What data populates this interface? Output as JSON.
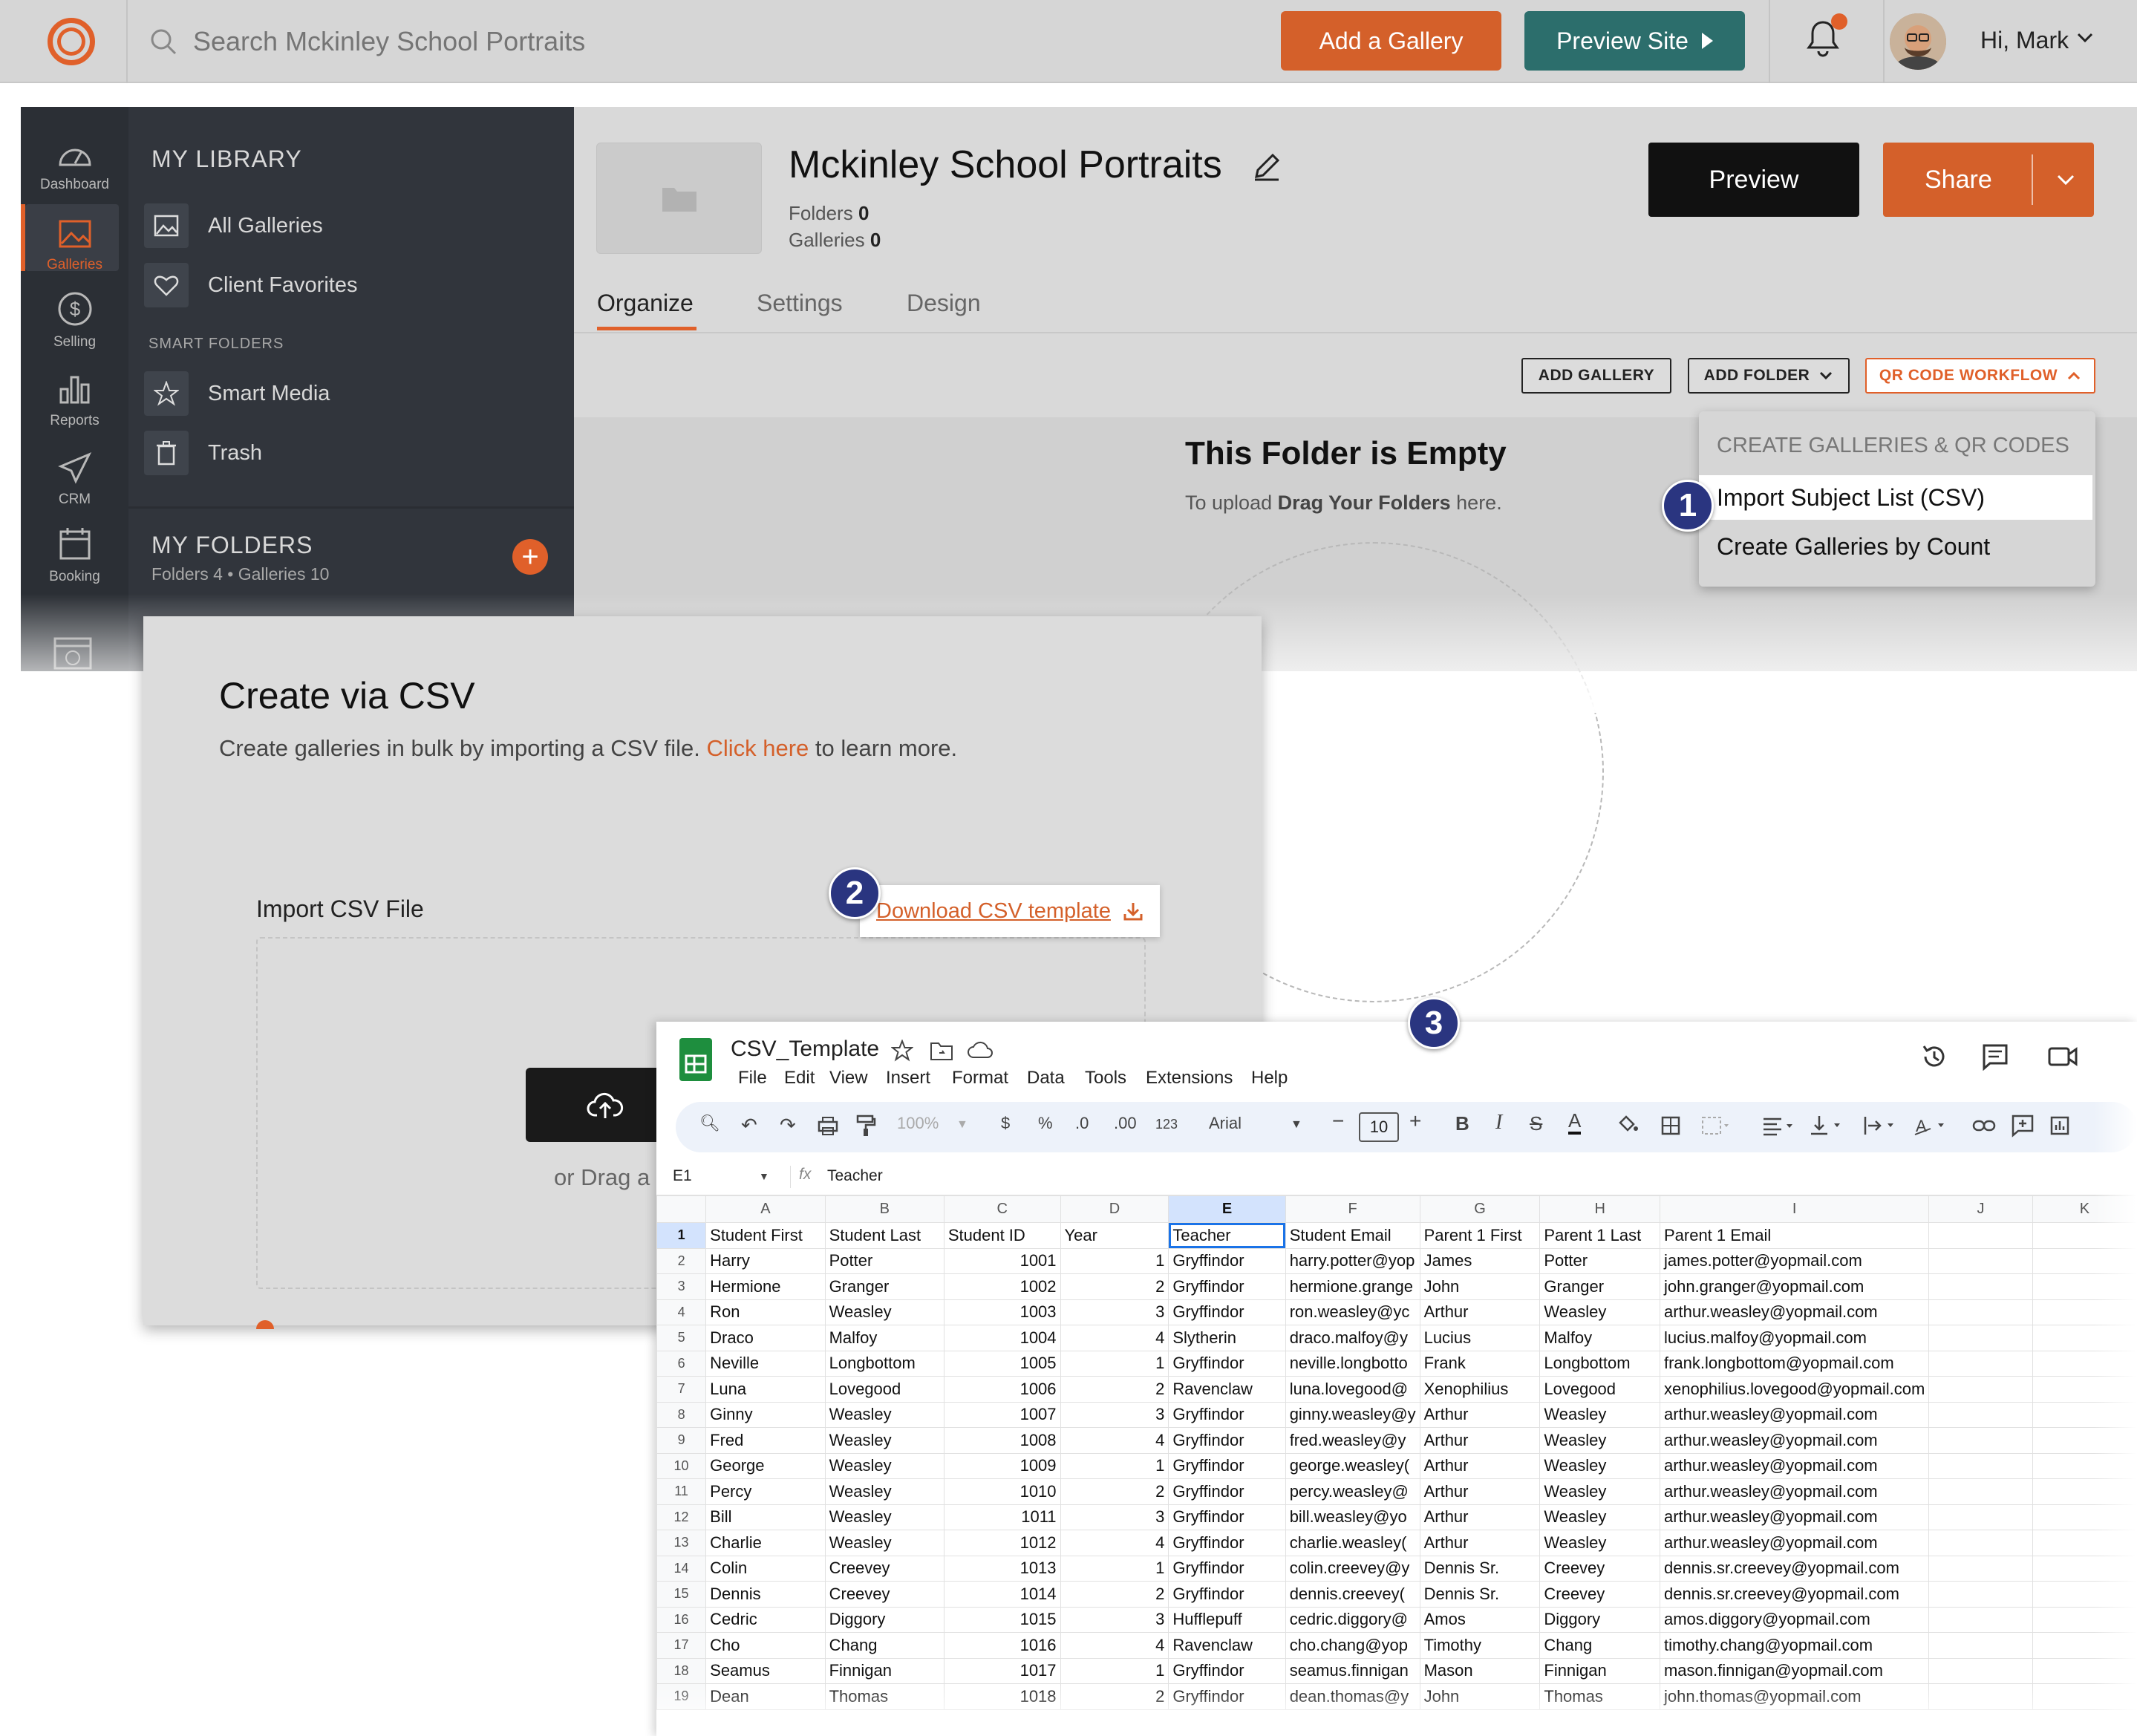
{
  "topbar": {
    "search_placeholder": "Search Mckinley School Portraits",
    "add_gallery": "Add a Gallery",
    "preview_site": "Preview Site",
    "greeting": "Hi, Mark"
  },
  "rail": {
    "items": [
      "Dashboard",
      "Galleries",
      "Selling",
      "Reports",
      "CRM",
      "Booking"
    ],
    "active": "Galleries"
  },
  "library": {
    "heading": "MY LIBRARY",
    "all_galleries": "All Galleries",
    "client_favorites": "Client Favorites",
    "smart_folders_heading": "SMART FOLDERS",
    "smart_media": "Smart Media",
    "trash": "Trash",
    "my_folders_heading": "MY FOLDERS",
    "my_folders_sub": "Folders 4 • Galleries 10"
  },
  "main": {
    "title": "Mckinley School Portraits",
    "folders_label": "Folders",
    "folders_count": "0",
    "galleries_label": "Galleries",
    "galleries_count": "0",
    "preview": "Preview",
    "share": "Share",
    "tabs": [
      "Organize",
      "Settings",
      "Design"
    ],
    "add_gallery_small": "ADD GALLERY",
    "add_folder_small": "ADD FOLDER",
    "qr_workflow": "QR CODE WORKFLOW",
    "empty_title": "This Folder is Empty",
    "empty_sub_prefix": "To upload ",
    "empty_sub_bold": "Drag Your Folders",
    "empty_sub_suffix": " here."
  },
  "dropdown": {
    "heading": "CREATE GALLERIES & QR CODES",
    "import": "Import Subject List (CSV)",
    "by_count": "Create Galleries by Count"
  },
  "badges": [
    "1",
    "2",
    "3"
  ],
  "modal": {
    "title": "Create via CSV",
    "desc_prefix": "Create galleries in bulk by importing a CSV file. ",
    "desc_link": "Click here",
    "desc_suffix": " to learn more.",
    "import_label": "Import CSV File",
    "download_template": "Download CSV template",
    "or_drag": "or Drag a"
  },
  "sheet": {
    "doc_title": "CSV_Template",
    "menu": [
      "File",
      "Edit",
      "View",
      "Insert",
      "Format",
      "Data",
      "Tools",
      "Extensions",
      "Help"
    ],
    "zoom": "100%",
    "currency": "$",
    "percent": "%",
    "dec_less": ".0",
    "dec_more": ".00",
    "number_format": "123",
    "font": "Arial",
    "font_size": "10",
    "cell_ref": "E1",
    "formula": "Teacher",
    "columns": [
      "A",
      "B",
      "C",
      "D",
      "E",
      "F",
      "G",
      "H",
      "I",
      "J",
      "K"
    ],
    "selected_column": "E",
    "rows": [
      [
        "1",
        "Student First",
        "Student Last",
        "Student ID",
        "Year",
        "Teacher",
        "Student Email",
        "Parent 1 First",
        "Parent 1 Last",
        "Parent 1 Email",
        "",
        ""
      ],
      [
        "2",
        "Harry",
        "Potter",
        "1001",
        "1",
        "Gryffindor",
        "harry.potter@yop",
        "James",
        "Potter",
        "james.potter@yopmail.com",
        "",
        ""
      ],
      [
        "3",
        "Hermione",
        "Granger",
        "1002",
        "2",
        "Gryffindor",
        "hermione.grange",
        "John",
        "Granger",
        "john.granger@yopmail.com",
        "",
        ""
      ],
      [
        "4",
        "Ron",
        "Weasley",
        "1003",
        "3",
        "Gryffindor",
        "ron.weasley@yc",
        "Arthur",
        "Weasley",
        "arthur.weasley@yopmail.com",
        "",
        ""
      ],
      [
        "5",
        "Draco",
        "Malfoy",
        "1004",
        "4",
        "Slytherin",
        "draco.malfoy@y",
        "Lucius",
        "Malfoy",
        "lucius.malfoy@yopmail.com",
        "",
        ""
      ],
      [
        "6",
        "Neville",
        "Longbottom",
        "1005",
        "1",
        "Gryffindor",
        "neville.longbotto",
        "Frank",
        "Longbottom",
        "frank.longbottom@yopmail.com",
        "",
        ""
      ],
      [
        "7",
        "Luna",
        "Lovegood",
        "1006",
        "2",
        "Ravenclaw",
        "luna.lovegood@",
        "Xenophilius",
        "Lovegood",
        "xenophilius.lovegood@yopmail.com",
        "",
        ""
      ],
      [
        "8",
        "Ginny",
        "Weasley",
        "1007",
        "3",
        "Gryffindor",
        "ginny.weasley@y",
        "Arthur",
        "Weasley",
        "arthur.weasley@yopmail.com",
        "",
        ""
      ],
      [
        "9",
        "Fred",
        "Weasley",
        "1008",
        "4",
        "Gryffindor",
        "fred.weasley@y",
        "Arthur",
        "Weasley",
        "arthur.weasley@yopmail.com",
        "",
        ""
      ],
      [
        "10",
        "George",
        "Weasley",
        "1009",
        "1",
        "Gryffindor",
        "george.weasley(",
        "Arthur",
        "Weasley",
        "arthur.weasley@yopmail.com",
        "",
        ""
      ],
      [
        "11",
        "Percy",
        "Weasley",
        "1010",
        "2",
        "Gryffindor",
        "percy.weasley@",
        "Arthur",
        "Weasley",
        "arthur.weasley@yopmail.com",
        "",
        ""
      ],
      [
        "12",
        "Bill",
        "Weasley",
        "1011",
        "3",
        "Gryffindor",
        "bill.weasley@yo",
        "Arthur",
        "Weasley",
        "arthur.weasley@yopmail.com",
        "",
        ""
      ],
      [
        "13",
        "Charlie",
        "Weasley",
        "1012",
        "4",
        "Gryffindor",
        "charlie.weasley(",
        "Arthur",
        "Weasley",
        "arthur.weasley@yopmail.com",
        "",
        ""
      ],
      [
        "14",
        "Colin",
        "Creevey",
        "1013",
        "1",
        "Gryffindor",
        "colin.creevey@y",
        "Dennis Sr.",
        "Creevey",
        "dennis.sr.creevey@yopmail.com",
        "",
        ""
      ],
      [
        "15",
        "Dennis",
        "Creevey",
        "1014",
        "2",
        "Gryffindor",
        "dennis.creevey(",
        "Dennis Sr.",
        "Creevey",
        "dennis.sr.creevey@yopmail.com",
        "",
        ""
      ],
      [
        "16",
        "Cedric",
        "Diggory",
        "1015",
        "3",
        "Hufflepuff",
        "cedric.diggory@",
        "Amos",
        "Diggory",
        "amos.diggory@yopmail.com",
        "",
        ""
      ],
      [
        "17",
        "Cho",
        "Chang",
        "1016",
        "4",
        "Ravenclaw",
        "cho.chang@yop",
        "Timothy",
        "Chang",
        "timothy.chang@yopmail.com",
        "",
        ""
      ],
      [
        "18",
        "Seamus",
        "Finnigan",
        "1017",
        "1",
        "Gryffindor",
        "seamus.finnigan",
        "Mason",
        "Finnigan",
        "mason.finnigan@yopmail.com",
        "",
        ""
      ],
      [
        "19",
        "Dean",
        "Thomas",
        "1018",
        "2",
        "Gryffindor",
        "dean.thomas@y",
        "John",
        "Thomas",
        "john.thomas@yopmail.com",
        "",
        ""
      ]
    ]
  },
  "colors": {
    "accent": "#e0602a",
    "teal": "#2c6e6c",
    "dark_panel": "#31353c",
    "badge": "#2a3580",
    "sheets_green": "#1e8e3e"
  }
}
